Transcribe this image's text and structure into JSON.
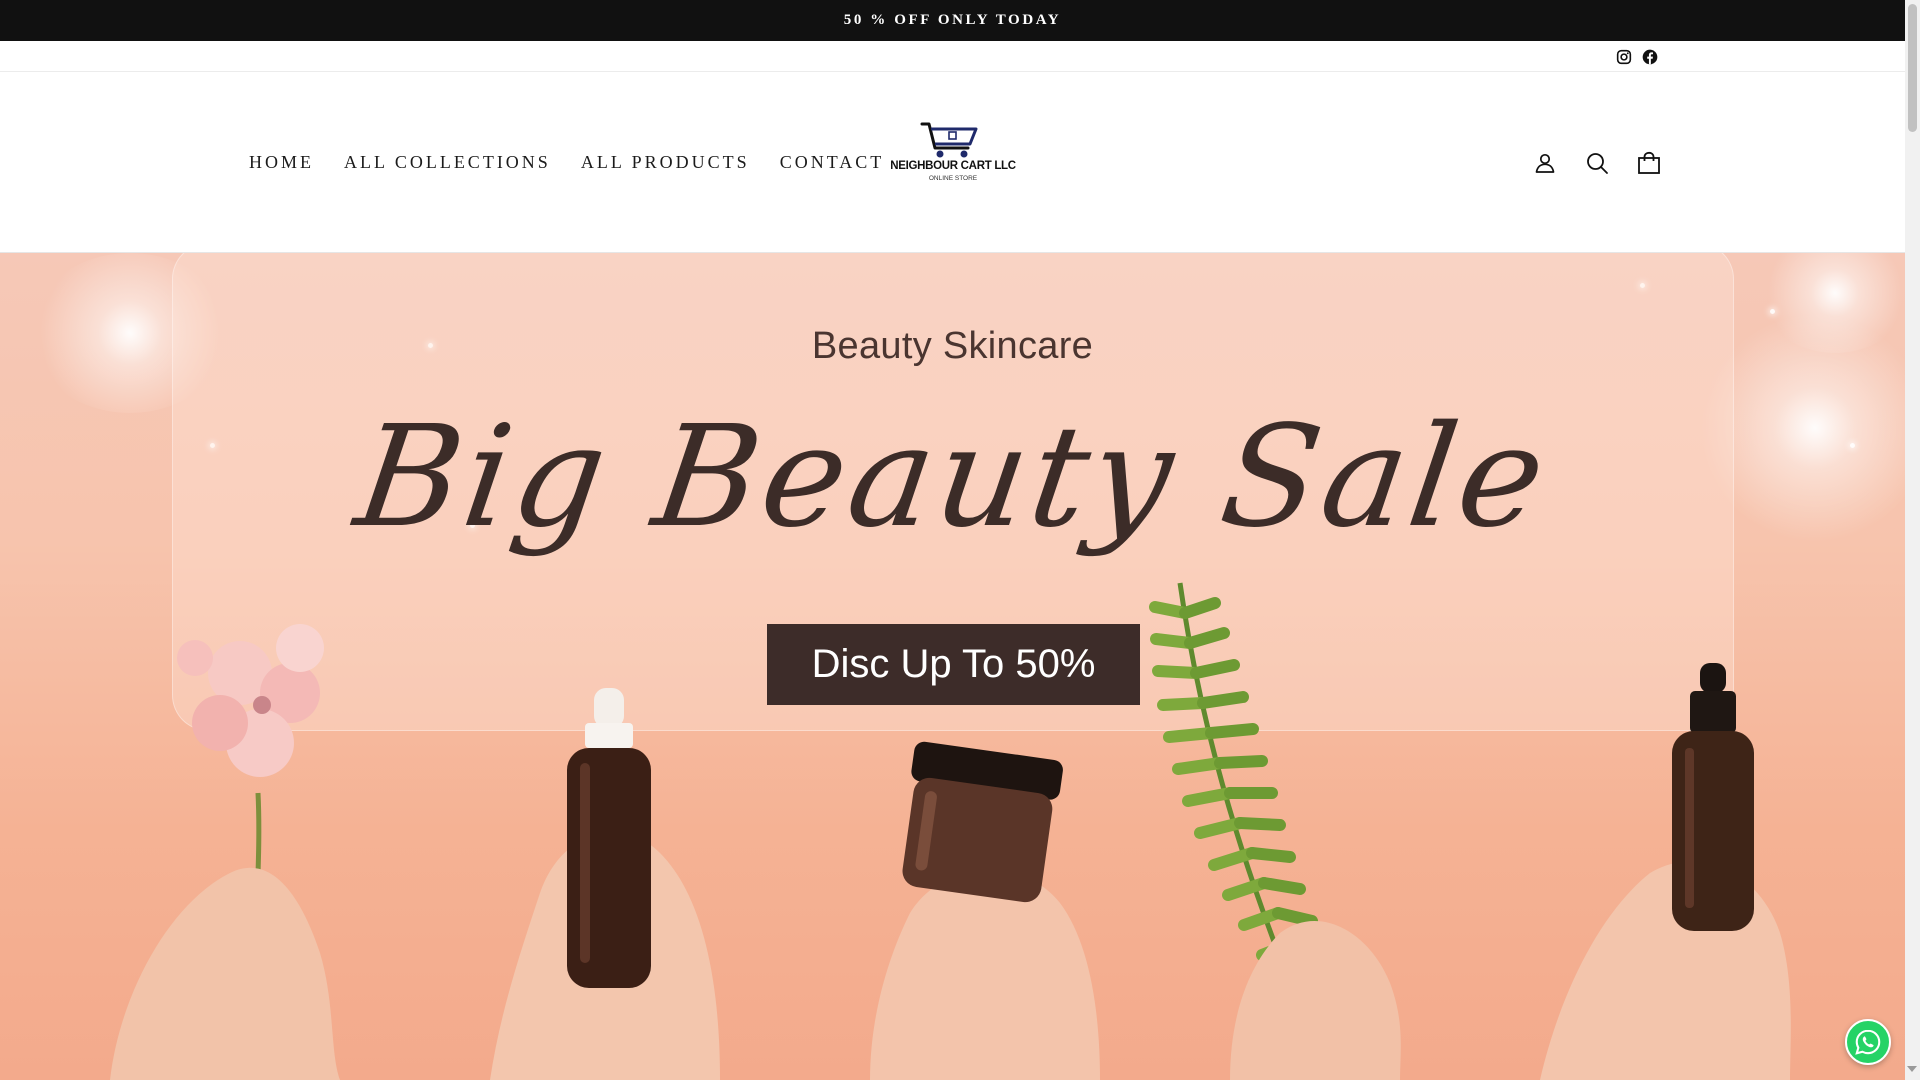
{
  "announcement": {
    "text": "50 % OFF ONLY TODAY"
  },
  "social": {
    "icons": [
      "instagram-icon",
      "facebook-icon"
    ]
  },
  "nav": {
    "items": [
      {
        "label": "HOME"
      },
      {
        "label": "ALL COLLECTIONS"
      },
      {
        "label": "ALL PRODUCTS"
      },
      {
        "label": "CONTACT"
      }
    ]
  },
  "logo": {
    "name": "NEIGHBOUR CART LLC",
    "tagline": "ONLINE STORE"
  },
  "header_icons": [
    "account-icon",
    "search-icon",
    "cart-icon"
  ],
  "hero": {
    "subtitle": "Beauty Skincare",
    "title": "Big Beauty Sale",
    "button": "Disc Up To 50%"
  },
  "colors": {
    "announcement_bg": "#111111",
    "hero_bg": "#f5b89c",
    "button_bg": "#3d2c29",
    "whatsapp": "#25d366"
  }
}
